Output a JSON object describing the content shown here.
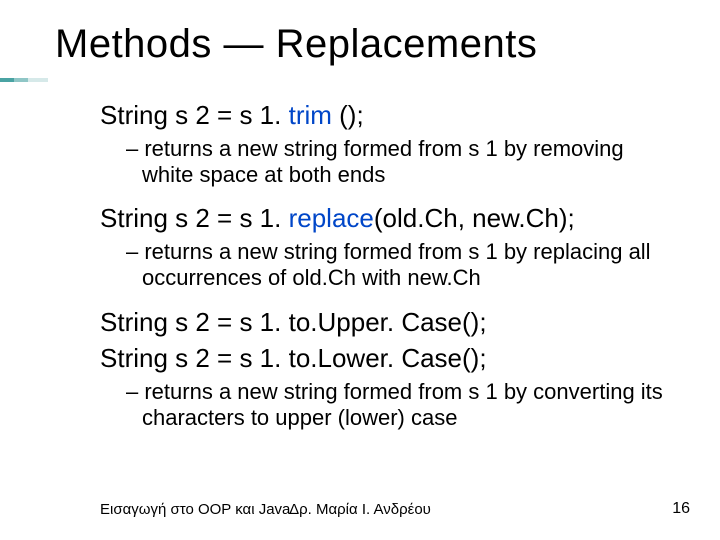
{
  "title": "Methods — Replacements",
  "items": [
    {
      "code_prefix": "String s 2 = s 1. ",
      "code_call": "trim",
      "code_suffix": " ();",
      "desc": "returns a new string formed from s 1 by removing white space at both ends"
    },
    {
      "code_prefix": "String s 2 = s 1. ",
      "code_call": "replace",
      "code_suffix": "(old.Ch, new.Ch);",
      "desc": "returns a new string formed from s 1 by replacing all occurrences of old.Ch with new.Ch"
    },
    {
      "code_lines": [
        "String s 2 = s 1. to.Upper. Case();",
        "String s 2 = s 1. to.Lower. Case();"
      ],
      "desc": "returns a new string formed from s 1 by converting its characters to upper (lower) case"
    }
  ],
  "footer": {
    "left": "Εισαγωγή στο OOP και Java",
    "center": "Δρ. Μαρία Ι. Ανδρέου",
    "right": "16"
  }
}
